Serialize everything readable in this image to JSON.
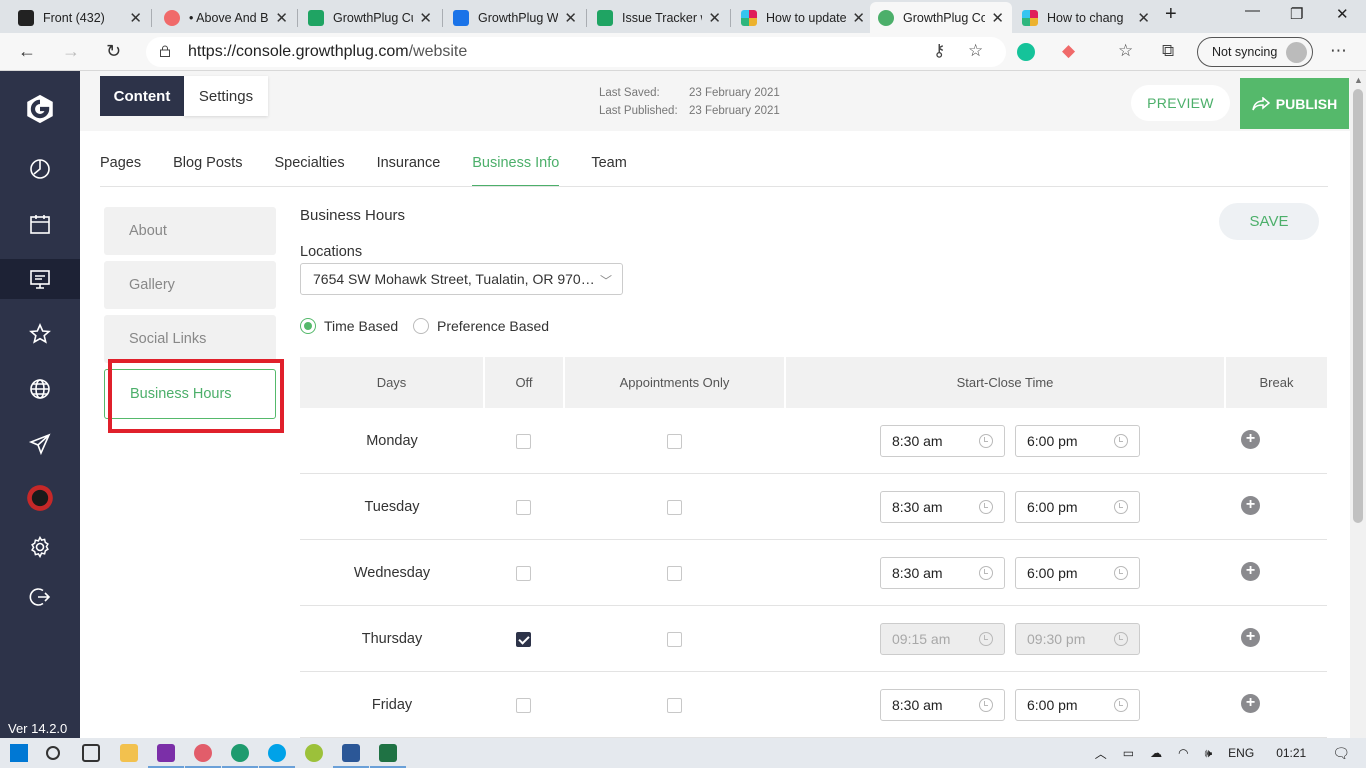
{
  "browser": {
    "tabs": [
      {
        "title": "Front (432)",
        "favicon_color": "#222222"
      },
      {
        "title": "• Above And B",
        "favicon_color": "#f06a6a"
      },
      {
        "title": "GrowthPlug Cu",
        "favicon_color": "#1fa463"
      },
      {
        "title": "GrowthPlug W",
        "favicon_color": "#1a73e8"
      },
      {
        "title": "Issue Tracker w",
        "favicon_color": "#1fa463"
      },
      {
        "title": "How to update",
        "favicon_color": "#e01e5a"
      },
      {
        "title": "GrowthPlug Co",
        "favicon_color": "#4caf6a",
        "active": true
      },
      {
        "title": "How to chang",
        "favicon_color": "#e01e5a"
      }
    ],
    "url_host": "https://console.growthplug.com",
    "url_path": "/website",
    "sync_label": "Not syncing"
  },
  "app": {
    "version": "Ver 14.2.0",
    "accent_color": "#55b96b",
    "sidebar_icons": [
      "logo-icon",
      "dashboard-icon",
      "calendar-icon",
      "website-icon",
      "star-icon",
      "globe-icon",
      "send-icon",
      "avatar-icon",
      "gear-icon",
      "logout-icon"
    ],
    "mode_tabs": {
      "content": "Content",
      "settings": "Settings"
    },
    "last_saved_label": "Last Saved:",
    "last_saved_value": "23 February 2021",
    "last_published_label": "Last Published:",
    "last_published_value": "23 February 2021",
    "preview_label": "PREVIEW",
    "publish_label": "PUBLISH",
    "content_tabs": [
      "Pages",
      "Blog Posts",
      "Specialties",
      "Insurance",
      "Business Info",
      "Team"
    ],
    "selected_content_tab": "Business Info",
    "side_nav": [
      "About",
      "Gallery",
      "Social Links",
      "Business Hours"
    ],
    "selected_side_nav": "Business Hours"
  },
  "business_hours": {
    "title": "Business Hours",
    "save_label": "SAVE",
    "locations_label": "Locations",
    "location_value": "7654 SW Mohawk Street, Tualatin, OR 970…",
    "radio_time_based": "Time Based",
    "radio_preference_based": "Preference Based",
    "selected_mode": "Time Based",
    "columns": [
      "Days",
      "Off",
      "Appointments Only",
      "Start-Close Time",
      "Break"
    ],
    "rows": [
      {
        "day": "Monday",
        "off": false,
        "appointments_only": false,
        "start": "8:30 am",
        "close": "6:00 pm"
      },
      {
        "day": "Tuesday",
        "off": false,
        "appointments_only": false,
        "start": "8:30 am",
        "close": "6:00 pm"
      },
      {
        "day": "Wednesday",
        "off": false,
        "appointments_only": false,
        "start": "8:30 am",
        "close": "6:00 pm"
      },
      {
        "day": "Thursday",
        "off": true,
        "appointments_only": false,
        "start": "09:15 am",
        "close": "09:30 pm"
      },
      {
        "day": "Friday",
        "off": false,
        "appointments_only": false,
        "start": "8:30 am",
        "close": "6:00 pm"
      }
    ]
  },
  "taskbar": {
    "language": "ENG",
    "clock": "01:21"
  }
}
